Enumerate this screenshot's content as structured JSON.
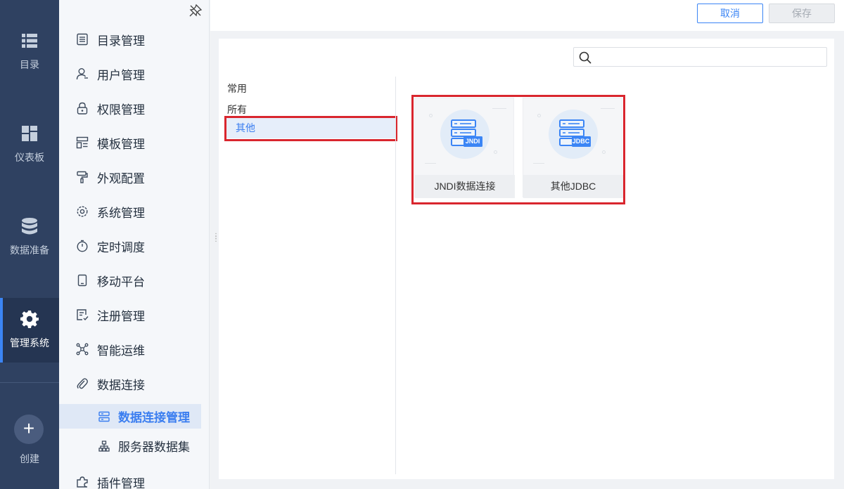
{
  "nav": {
    "items": [
      {
        "label": "目录",
        "icon": "list-icon"
      },
      {
        "label": "仪表板",
        "icon": "dashboard-icon"
      },
      {
        "label": "数据准备",
        "icon": "database-icon"
      },
      {
        "label": "管理系统",
        "icon": "gear-icon"
      }
    ],
    "create_label": "创建",
    "create_symbol": "+"
  },
  "menu": {
    "items": [
      {
        "label": "目录管理",
        "icon": "catalog-icon"
      },
      {
        "label": "用户管理",
        "icon": "user-icon"
      },
      {
        "label": "权限管理",
        "icon": "lock-icon"
      },
      {
        "label": "模板管理",
        "icon": "template-icon"
      },
      {
        "label": "外观配置",
        "icon": "paint-roller-icon"
      },
      {
        "label": "系统管理",
        "icon": "settings-icon"
      },
      {
        "label": "定时调度",
        "icon": "timer-icon"
      },
      {
        "label": "移动平台",
        "icon": "mobile-icon"
      },
      {
        "label": "注册管理",
        "icon": "register-icon"
      },
      {
        "label": "智能运维",
        "icon": "network-icon"
      },
      {
        "label": "数据连接",
        "icon": "paperclip-icon"
      },
      {
        "label": "插件管理",
        "icon": "plugin-icon"
      }
    ],
    "sub_items": [
      {
        "label": "数据连接管理",
        "icon": "connection-manage-icon",
        "active": true
      },
      {
        "label": "服务器数据集",
        "icon": "server-dataset-icon",
        "active": false
      }
    ]
  },
  "toolbar": {
    "cancel_label": "取消",
    "save_label": "保存"
  },
  "search": {
    "placeholder": "",
    "value": ""
  },
  "categories": {
    "common": "常用",
    "all": "所有",
    "other": "其他"
  },
  "tiles": [
    {
      "name": "JNDI数据连接",
      "badge": "JNDI"
    },
    {
      "name": "其他JDBC",
      "badge": "JDBC"
    }
  ],
  "colors": {
    "accent": "#3b85f5",
    "nav_bg": "#2f4161",
    "highlight_box": "#d9262e"
  }
}
